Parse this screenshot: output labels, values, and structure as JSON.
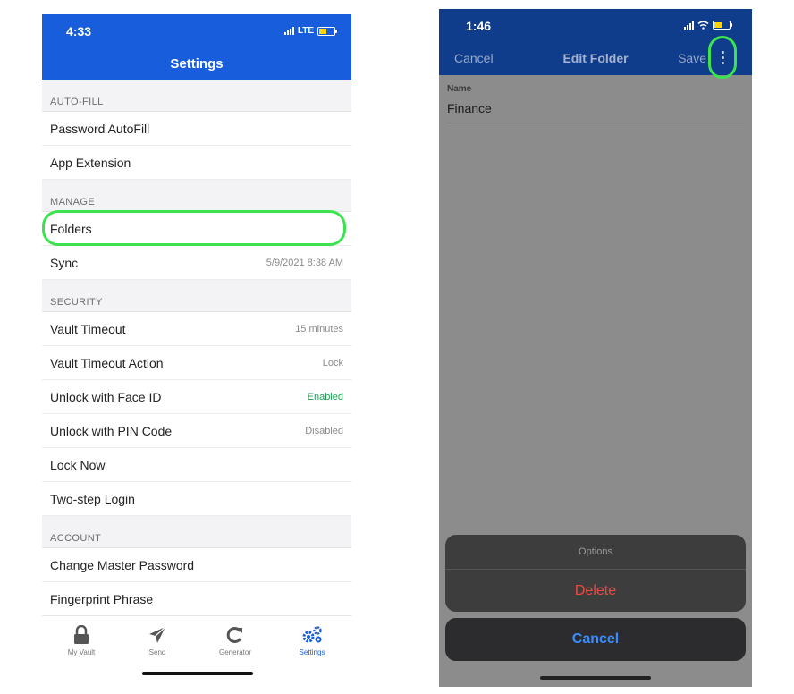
{
  "left": {
    "status": {
      "time": "4:33",
      "network": "LTE"
    },
    "title": "Settings",
    "sections": [
      {
        "header": "AUTO-FILL",
        "rows": [
          {
            "label": "Password AutoFill",
            "value": ""
          },
          {
            "label": "App Extension",
            "value": ""
          }
        ]
      },
      {
        "header": "MANAGE",
        "rows": [
          {
            "label": "Folders",
            "value": ""
          },
          {
            "label": "Sync",
            "value": "5/9/2021 8:38 AM"
          }
        ]
      },
      {
        "header": "SECURITY",
        "rows": [
          {
            "label": "Vault Timeout",
            "value": "15 minutes"
          },
          {
            "label": "Vault Timeout Action",
            "value": "Lock"
          },
          {
            "label": "Unlock with Face ID",
            "value": "Enabled"
          },
          {
            "label": "Unlock with PIN Code",
            "value": "Disabled"
          },
          {
            "label": "Lock Now",
            "value": ""
          },
          {
            "label": "Two-step Login",
            "value": ""
          }
        ]
      },
      {
        "header": "ACCOUNT",
        "rows": [
          {
            "label": "Change Master Password",
            "value": ""
          },
          {
            "label": "Fingerprint Phrase",
            "value": ""
          }
        ]
      }
    ],
    "tabs": [
      {
        "label": "My Vault",
        "icon": "lock-icon"
      },
      {
        "label": "Send",
        "icon": "send-icon"
      },
      {
        "label": "Generator",
        "icon": "refresh-icon"
      },
      {
        "label": "Settings",
        "icon": "gears-icon",
        "active": true
      }
    ],
    "colors": {
      "header": "#175ddc",
      "enabled": "#1e9e52",
      "highlight": "#3ce34f"
    }
  },
  "right": {
    "status": {
      "time": "1:46"
    },
    "nav": {
      "cancel": "Cancel",
      "title": "Edit Folder",
      "save": "Save"
    },
    "field": {
      "label": "Name",
      "value": "Finance"
    },
    "sheet": {
      "title": "Options",
      "delete": "Delete",
      "cancel": "Cancel"
    }
  }
}
